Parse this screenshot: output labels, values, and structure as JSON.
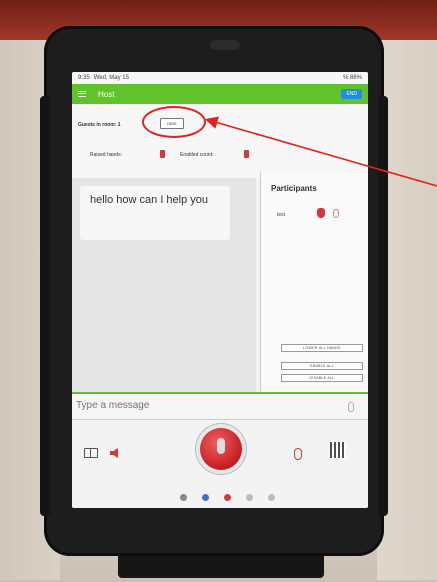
{
  "statusbar": {
    "time": "9:35",
    "date": "Wed, May 15",
    "battery": "% 86%"
  },
  "appbar": {
    "title": "Host",
    "end_label": "END"
  },
  "info": {
    "guests_label": "Guests in room: 1",
    "hide_label": "HIDE",
    "raised_hands_label": "Raised hands:",
    "enabled_count_label": "Enabled count:"
  },
  "chat": {
    "message": "hello how can I help you"
  },
  "participants": {
    "title": "Participants",
    "names": [
      "test"
    ],
    "lower_all_hands": "LOWER ALL HANDS",
    "enable_all": "ENABLE ALL",
    "disable_all": "DISABLE ALL"
  },
  "composer": {
    "placeholder": "Type a message"
  },
  "icons": [
    "book-icon",
    "speaker-icon",
    "microphone-icon",
    "mute-mic-icon",
    "qr-code-icon",
    "menu-icon",
    "paperclip-icon"
  ],
  "colors": {
    "appbar": "#62c22b",
    "end_button": "#1d8fe0",
    "accent_red": "#d9363d",
    "annotation": "#e32222"
  }
}
